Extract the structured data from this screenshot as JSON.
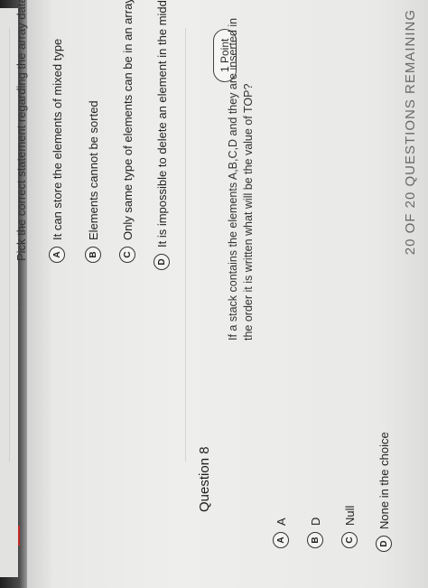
{
  "header": {
    "remaining": "20 of 20 questions remaining",
    "close_icon": "close-icon"
  },
  "question7": {
    "prompt": "Pick the correct statement regarding the array data structure.",
    "options": [
      {
        "letter": "A",
        "text": "It can store the elements of mixed type"
      },
      {
        "letter": "B",
        "text": "Elements cannot be sorted"
      },
      {
        "letter": "C",
        "text": "Only same type of elements can be in an array"
      },
      {
        "letter": "D",
        "text": "It is impossible to delete an element in the middle of array"
      }
    ]
  },
  "question8": {
    "title": "Question 8",
    "points": "1 Point",
    "text": "If a stack contains the elements A,B,C,D and they are inserted in the order it is written what will be the value of TOP?",
    "options": [
      {
        "letter": "A",
        "text": "A"
      },
      {
        "letter": "B",
        "text": "D"
      },
      {
        "letter": "C",
        "text": "Null"
      },
      {
        "letter": "D",
        "text": "None in the choice"
      }
    ]
  }
}
